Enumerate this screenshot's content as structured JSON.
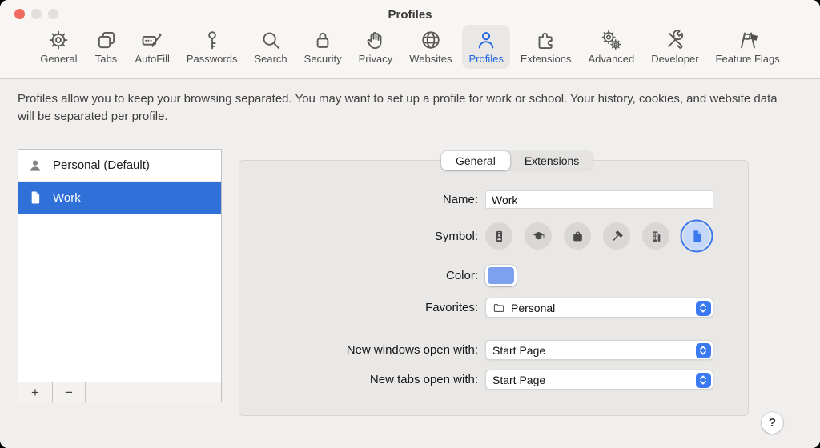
{
  "window": {
    "title": "Profiles"
  },
  "toolbar": {
    "items": [
      {
        "label": "General",
        "icon": "gear-icon"
      },
      {
        "label": "Tabs",
        "icon": "tabs-icon"
      },
      {
        "label": "AutoFill",
        "icon": "autofill-icon"
      },
      {
        "label": "Passwords",
        "icon": "key-icon"
      },
      {
        "label": "Search",
        "icon": "magnifier-icon"
      },
      {
        "label": "Security",
        "icon": "lock-icon"
      },
      {
        "label": "Privacy",
        "icon": "hand-icon"
      },
      {
        "label": "Websites",
        "icon": "globe-icon"
      },
      {
        "label": "Profiles",
        "icon": "person-icon",
        "selected": true
      },
      {
        "label": "Extensions",
        "icon": "puzzle-icon"
      },
      {
        "label": "Advanced",
        "icon": "gears-icon"
      },
      {
        "label": "Developer",
        "icon": "tools-icon"
      },
      {
        "label": "Feature Flags",
        "icon": "flags-icon"
      }
    ]
  },
  "description": "Profiles allow you to keep your browsing separated. You may want to set up a profile for work or school. Your history, cookies, and website data will be separated per profile.",
  "profiles_list": {
    "items": [
      {
        "name": "Personal (Default)",
        "icon": "person-icon",
        "selected": false
      },
      {
        "name": "Work",
        "icon": "document-icon",
        "selected": true
      }
    ],
    "add_label": "+",
    "remove_label": "−"
  },
  "detail": {
    "tabs": [
      {
        "label": "General",
        "selected": true
      },
      {
        "label": "Extensions",
        "selected": false
      }
    ],
    "name_label": "Name:",
    "name_value": "Work",
    "symbol_label": "Symbol:",
    "symbols": [
      {
        "icon": "id-badge-icon",
        "selected": false
      },
      {
        "icon": "graduation-cap-icon",
        "selected": false
      },
      {
        "icon": "briefcase-icon",
        "selected": false
      },
      {
        "icon": "hammer-icon",
        "selected": false
      },
      {
        "icon": "building-icon",
        "selected": false
      },
      {
        "icon": "document-icon",
        "selected": true
      }
    ],
    "color_label": "Color:",
    "favorites_label": "Favorites:",
    "favorites_value": "Personal",
    "new_windows_label": "New windows open with:",
    "new_windows_value": "Start Page",
    "new_tabs_label": "New tabs open with:",
    "new_tabs_value": "Start Page"
  },
  "help_button": "?",
  "colors": {
    "accent": "#2066df",
    "selection": "#3071d9",
    "swatch": "#7da1ef",
    "ring": "#3b78ee",
    "stepper": "#3b79f0",
    "tl-red": "#ee6a5f",
    "tl-gray": "#e0dfde"
  }
}
